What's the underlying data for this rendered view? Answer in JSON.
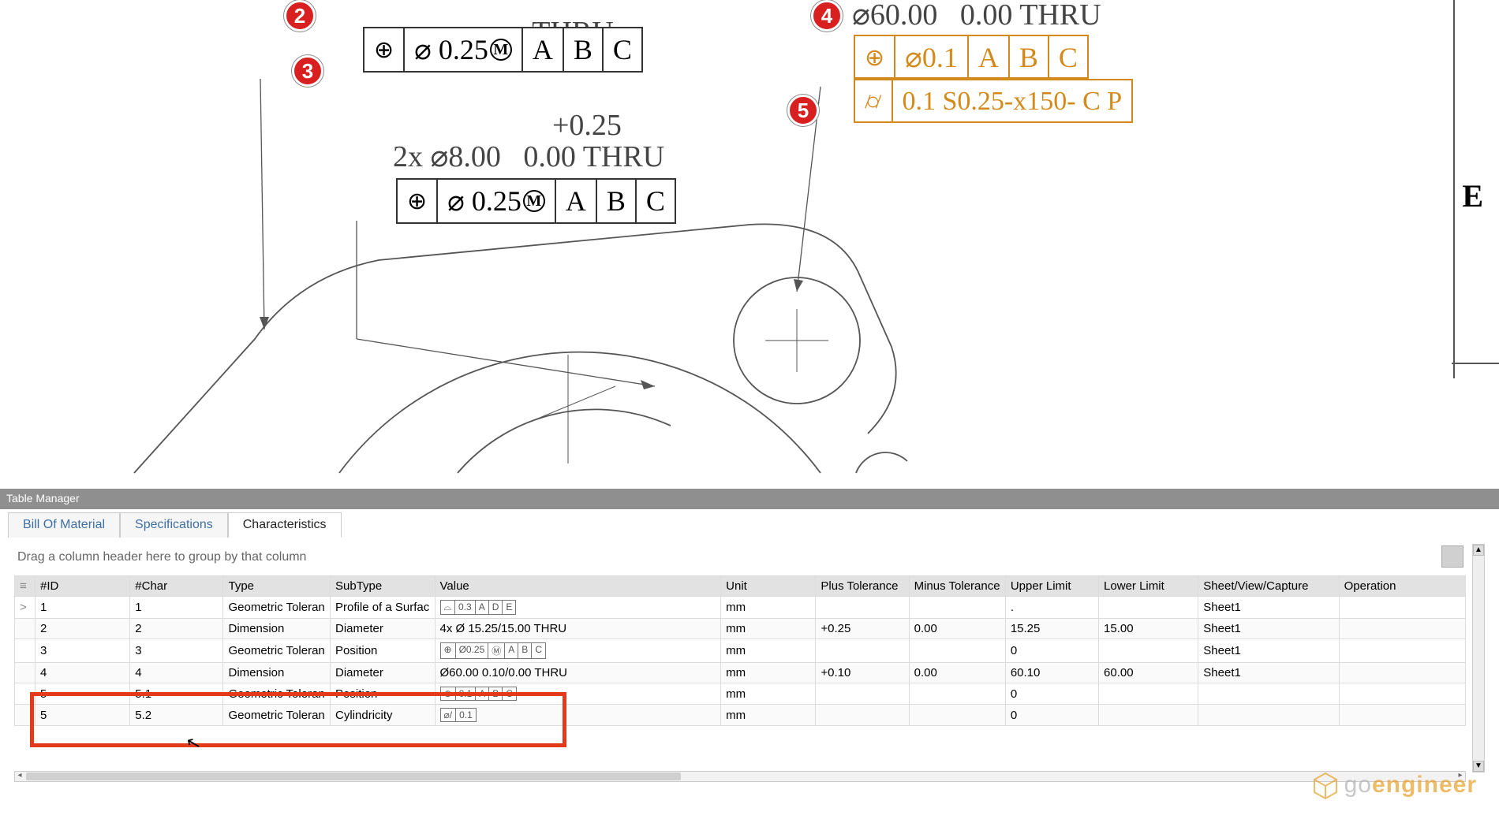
{
  "balloons": {
    "b2": "2",
    "b3": "3",
    "b4": "4",
    "b5": "5"
  },
  "dims": {
    "dim1_qty": "4x ⌀",
    "dim1_nom": "15.00",
    "dim1_thru": "THRU",
    "dim2_plus": "+0.25",
    "dim2_line": "2x ⌀8.00   0.00 THRU",
    "dim3_line": "⌀60.00   0.00 THRU"
  },
  "fcf1": {
    "sym": "⊕",
    "tol": "⌀ 0.25",
    "m": "M",
    "d1": "A",
    "d2": "B",
    "d3": "C"
  },
  "fcf2": {
    "sym": "⊕",
    "tol": "⌀ 0.25",
    "m": "M",
    "d1": "A",
    "d2": "B",
    "d3": "C"
  },
  "fcf3": {
    "sym": "⊕",
    "tol": "⌀0.1",
    "d1": "A",
    "d2": "B",
    "d3": "C"
  },
  "fcf4": {
    "sym": "⌀/",
    "tol": "0.1 S0.25-x150- C P"
  },
  "zone_e": "E",
  "panel": {
    "title": "Table Manager",
    "tabs": {
      "bom": "Bill Of Material",
      "specs": "Specifications",
      "chars": "Characteristics"
    },
    "group_hint": "Drag a column header here to group by that column",
    "columns": {
      "id": "#ID",
      "char": "#Char",
      "type": "Type",
      "subtype": "SubType",
      "value": "Value",
      "unit": "Unit",
      "plus": "Plus Tolerance",
      "minus": "Minus Tolerance",
      "upper": "Upper Limit",
      "lower": "Lower Limit",
      "sheet": "Sheet/View/Capture",
      "op": "Operation"
    },
    "rows": [
      {
        "handle": ">",
        "id": "1",
        "char": "1",
        "type": "Geometric Toleran",
        "subtype": "Profile of a Surfac",
        "value_pill": [
          "⌓",
          "0.3",
          "A",
          "D",
          "E"
        ],
        "unit": "mm",
        "plus": "",
        "minus": "",
        "upper": ".",
        "lower": "",
        "sheet": "Sheet1",
        "op": ""
      },
      {
        "handle": "",
        "id": "2",
        "char": "2",
        "type": "Dimension",
        "subtype": "Diameter",
        "value_text": "4x Ø 15.25/15.00 THRU",
        "unit": "mm",
        "plus": "+0.25",
        "minus": "0.00",
        "upper": "15.25",
        "lower": "15.00",
        "sheet": "Sheet1",
        "op": ""
      },
      {
        "handle": "",
        "id": "3",
        "char": "3",
        "type": "Geometric Toleran",
        "subtype": "Position",
        "value_pill": [
          "⊕",
          "Ø0.25",
          "Ⓜ",
          "A",
          "B",
          "C"
        ],
        "unit": "mm",
        "plus": "",
        "minus": "",
        "upper": "0",
        "lower": "",
        "sheet": "Sheet1",
        "op": ""
      },
      {
        "handle": "",
        "id": "4",
        "char": "4",
        "type": "Dimension",
        "subtype": "Diameter",
        "value_text": "Ø60.00 0.10/0.00 THRU",
        "unit": "mm",
        "plus": "+0.10",
        "minus": "0.00",
        "upper": "60.10",
        "lower": "60.00",
        "sheet": "Sheet1",
        "op": ""
      },
      {
        "handle": "",
        "id": "5",
        "char": "5.1",
        "type": "Geometric Toleran",
        "subtype": "Position",
        "value_pill": [
          "⊕",
          "0.1",
          "A",
          "B",
          "C"
        ],
        "unit": "mm",
        "plus": "",
        "minus": "",
        "upper": "0",
        "lower": "",
        "sheet": "",
        "op": ""
      },
      {
        "handle": "",
        "id": "5",
        "char": "5.2",
        "type": "Geometric Toleran",
        "subtype": "Cylindricity",
        "value_pill": [
          "⌀/",
          "0.1"
        ],
        "unit": "mm",
        "plus": "",
        "minus": "",
        "upper": "0",
        "lower": "",
        "sheet": "",
        "op": ""
      }
    ]
  },
  "logo": {
    "text_pre": "go",
    "text_post": "engineer"
  }
}
